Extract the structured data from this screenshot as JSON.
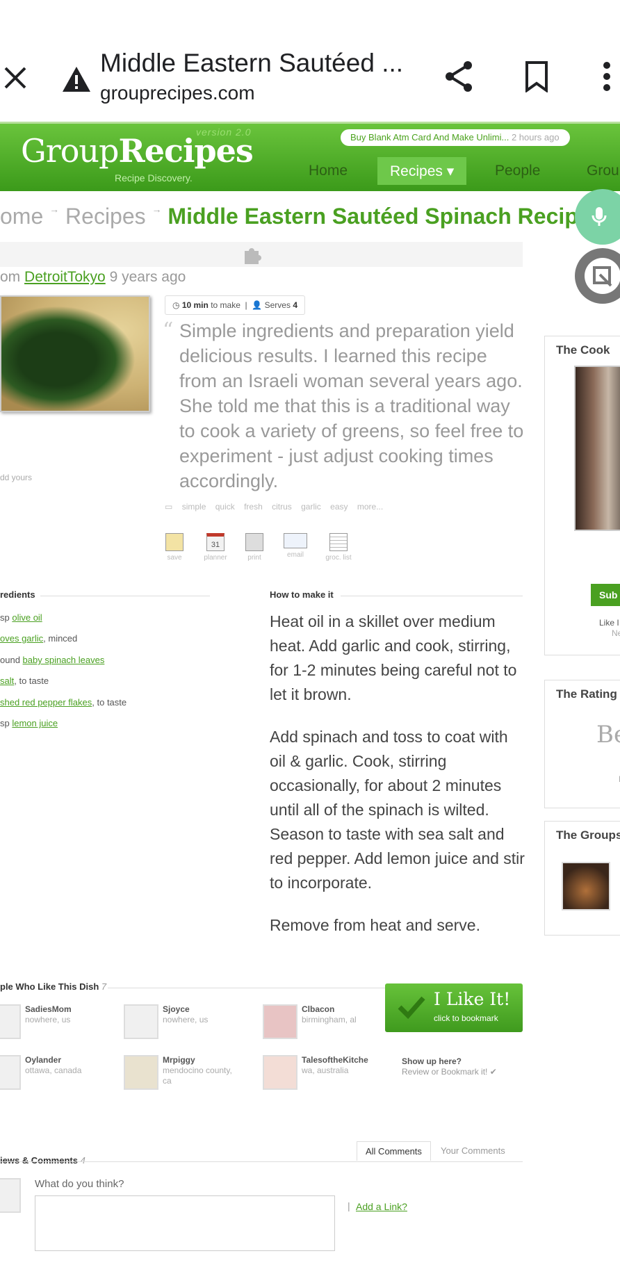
{
  "browser": {
    "title": "Middle Eastern Sautéed ...",
    "url": "grouprecipes.com",
    "close_icon": "close-icon",
    "warning_icon": "warning-icon",
    "share_icon": "share-icon",
    "bookmark_icon": "bookmark-icon",
    "menu_icon": "more-vert-icon"
  },
  "header": {
    "logo_light": "Group",
    "logo_bold": "Recipes",
    "version": "version 2.0",
    "tagline": "Recipe Discovery.",
    "ad_text": "Buy Blank Atm Card And Make Unlimi...",
    "ad_time": "2 hours ago",
    "nav": [
      "Home",
      "Recipes ▾",
      "People",
      "Grou"
    ],
    "accent": "#4aa021"
  },
  "crumbs": {
    "home": "ome",
    "recipes": "Recipes",
    "title": "Middle Eastern Sautéed Spinach Recipe"
  },
  "byline": {
    "prefix": "om",
    "author": "DetroitTokyo",
    "time": "9 years ago"
  },
  "photo": {
    "add_yours": "dd yours"
  },
  "meta": {
    "time": "10 min",
    "time_suffix": "to make",
    "serves_label": "Serves",
    "serves": "4"
  },
  "description": "Simple ingredients and preparation yield delicious results. I learned this recipe from an Israeli woman several years ago. She told me that this is a traditional way to cook a variety of greens, so feel free to experiment - just adjust cooking times accordingly.",
  "tags": [
    "simple",
    "quick",
    "fresh",
    "citrus",
    "garlic",
    "easy",
    "more..."
  ],
  "tools": [
    {
      "label": "save",
      "icon": "save-icon"
    },
    {
      "label": "planner",
      "icon": "calendar-icon",
      "num": "31"
    },
    {
      "label": "print",
      "icon": "printer-icon"
    },
    {
      "label": "email",
      "icon": "email-icon"
    },
    {
      "label": "groc. list",
      "icon": "list-icon"
    }
  ],
  "ingredients": {
    "header": "redients",
    "items": [
      {
        "pre": "sp ",
        "link": "olive oil",
        "post": ""
      },
      {
        "pre": "",
        "link": "oves garlic",
        "post": ", minced"
      },
      {
        "pre": "ound ",
        "link": "baby spinach leaves",
        "post": ""
      },
      {
        "pre": "",
        "link": " salt",
        "post": ", to taste"
      },
      {
        "pre": "",
        "link": "shed red pepper flakes",
        "post": ", to taste"
      },
      {
        "pre": "sp ",
        "link": "lemon juice",
        "post": ""
      }
    ]
  },
  "method": {
    "header": "How to make it",
    "steps": [
      "Heat oil in a skillet over medium heat. Add garlic and cook, stirring, for 1-2 minutes being careful not to let it brown.",
      "Add spinach and toss to coat with oil & garlic. Cook, stirring occasionally, for about 2 minutes until all of the spinach is wilted. Season to taste with sea salt and red pepper. Add lemon juice and stir to incorporate.",
      "Remove from heat and serve."
    ]
  },
  "people": {
    "header": "ple Who Like This Dish",
    "count": "7",
    "items": [
      {
        "name": "SadiesMom",
        "loc": "nowhere, us"
      },
      {
        "name": "Sjoyce",
        "loc": "nowhere, us"
      },
      {
        "name": "Clbacon",
        "loc": "birmingham, al"
      },
      {
        "name": "Oylander",
        "loc": "ottawa, canada"
      },
      {
        "name": "Mrpiggy",
        "loc": "mendocino county, ca"
      },
      {
        "name": "TalesoftheKitche",
        "loc": "wa, australia"
      }
    ],
    "show_title": "Show up here?",
    "show_sub": "Review or Bookmark it! ✔"
  },
  "like": {
    "title": "I Like It!",
    "sub": "click to bookmark"
  },
  "reviews": {
    "header": "iews & Comments",
    "count": "4",
    "tab_all": "All Comments",
    "tab_yours": "Your Comments",
    "prompt": "What do you think?",
    "add_link": "Add a Link?"
  },
  "sidebar": {
    "cook": "The Cook",
    "subscribe": "Sub",
    "like_text": "Like I",
    "like_sub": "Ne",
    "rating": "The Rating",
    "rating_val": "Be",
    "rating_sub": "Re",
    "groups": "The Groups"
  }
}
